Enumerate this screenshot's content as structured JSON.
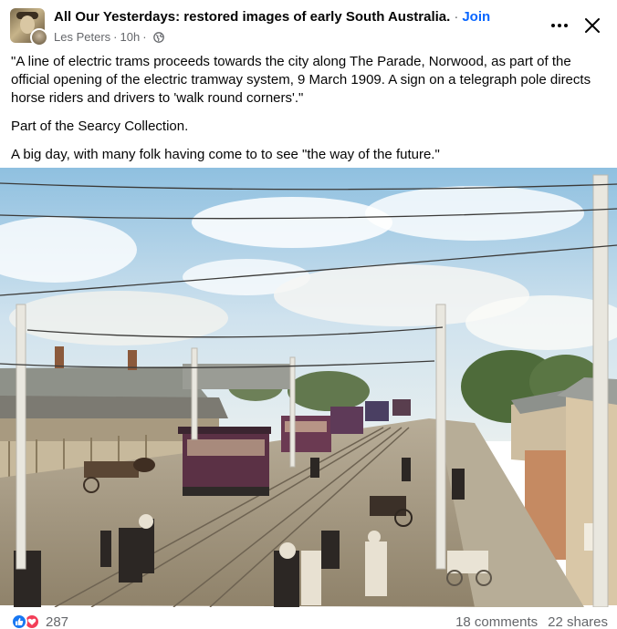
{
  "header": {
    "group_name": "All Our Yesterdays: restored images of early South Australia.",
    "join_label": "Join",
    "author": "Les Peters",
    "time": "10h",
    "more_icon": "more-horizontal-icon",
    "close_icon": "close-icon",
    "privacy_icon": "globe-icon"
  },
  "post": {
    "paragraphs": [
      "\"A line of electric trams proceeds towards the city along The Parade, Norwood, as part of the official opening of the electric tramway system, 9 March 1909. A sign on a telegraph pole directs horse riders and drivers to 'walk round corners'.\"",
      "Part of the Searcy Collection.",
      "A big day, with many folk having come to to see \"the way of the future.\""
    ]
  },
  "footer": {
    "reaction_count": "287",
    "comments": "18 comments",
    "shares": "22 shares"
  },
  "colors": {
    "link_blue": "#0866ff",
    "secondary_text": "#65676b",
    "like_blue": "#1877f2",
    "love_red": "#f33e58"
  }
}
